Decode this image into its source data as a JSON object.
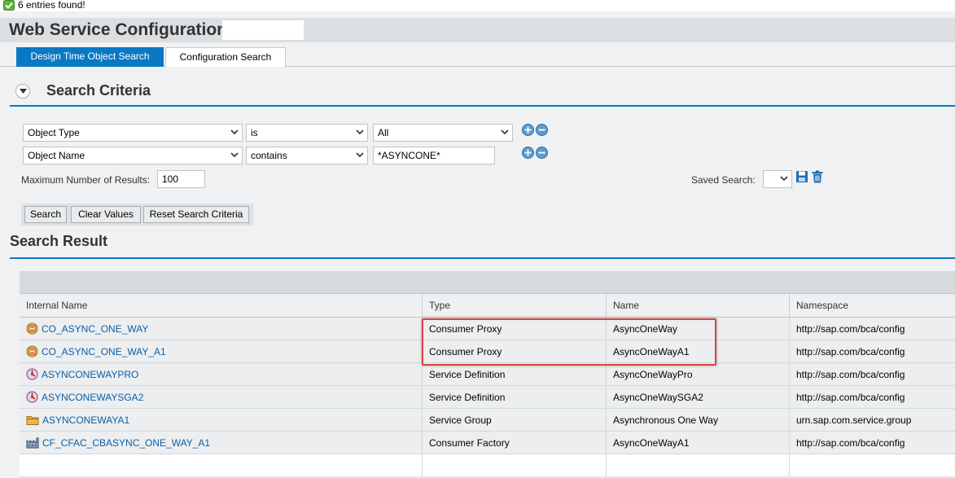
{
  "message": {
    "text": "6 entries found!"
  },
  "page": {
    "title": "Web Service Configuration"
  },
  "tabs": [
    {
      "label": "Design Time Object Search",
      "active": true
    },
    {
      "label": "Configuration Search",
      "active": false
    }
  ],
  "search_criteria": {
    "title": "Search Criteria",
    "rows": [
      {
        "attribute": "Object Type",
        "operator": "is",
        "value": "All"
      },
      {
        "attribute": "Object Name",
        "operator": "contains",
        "value": "*ASYNCONE*"
      }
    ],
    "max_results_label": "Maximum Number of Results:",
    "max_results_value": "100",
    "saved_search_label": "Saved Search:",
    "saved_search_value": "",
    "buttons": {
      "search": "Search",
      "clear": "Clear Values",
      "reset": "Reset Search Criteria"
    }
  },
  "search_result": {
    "title": "Search Result",
    "columns": [
      "Internal Name",
      "Type",
      "Name",
      "Namespace"
    ],
    "rows": [
      {
        "icon": "consumer-proxy-icon",
        "internal_name": "CO_ASYNC_ONE_WAY",
        "type": "Consumer Proxy",
        "name": "AsyncOneWay",
        "namespace": "http://sap.com/bca/config"
      },
      {
        "icon": "consumer-proxy-icon",
        "internal_name": "CO_ASYNC_ONE_WAY_A1",
        "type": "Consumer Proxy",
        "name": "AsyncOneWayA1",
        "namespace": "http://sap.com/bca/config"
      },
      {
        "icon": "service-definition-icon",
        "internal_name": "ASYNCONEWAYPRO",
        "type": "Service Definition",
        "name": "AsyncOneWayPro",
        "namespace": "http://sap.com/bca/config"
      },
      {
        "icon": "service-definition-icon",
        "internal_name": "ASYNCONEWAYSGA2",
        "type": "Service Definition",
        "name": "AsyncOneWaySGA2",
        "namespace": "http://sap.com/bca/config"
      },
      {
        "icon": "service-group-icon",
        "internal_name": "ASYNCONEWAYA1",
        "type": "Service Group",
        "name": "Asynchronous One Way",
        "namespace": "urn.sap.com.service.group"
      },
      {
        "icon": "consumer-factory-icon",
        "internal_name": "CF_CFAC_CBASYNC_ONE_WAY_A1",
        "type": "Consumer Factory",
        "name": "AsyncOneWayA1",
        "namespace": "http://sap.com/bca/config"
      }
    ]
  },
  "colors": {
    "accent": "#0a78c2",
    "link": "#0b5fa5",
    "highlight": "#e0443e"
  }
}
